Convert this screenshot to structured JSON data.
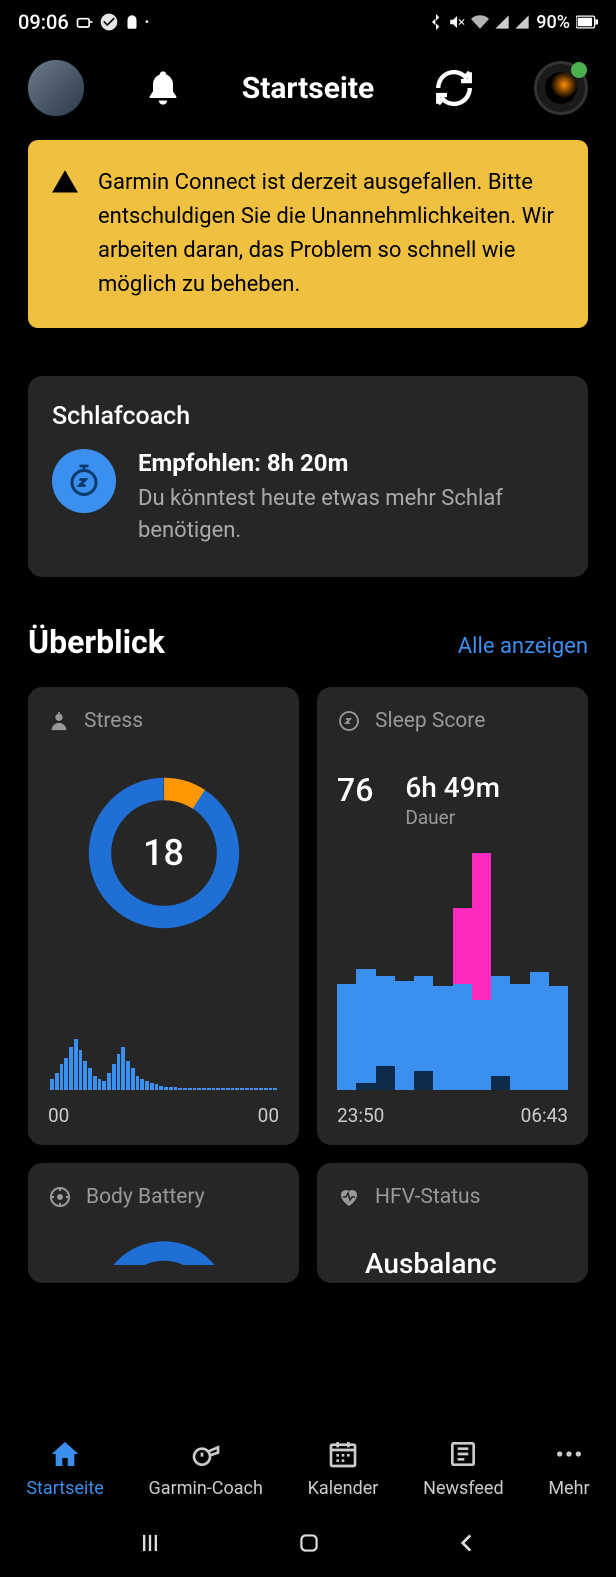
{
  "status": {
    "time": "09:06",
    "battery": "90%"
  },
  "header": {
    "title": "Startseite"
  },
  "alert": {
    "text": "Garmin Connect ist derzeit ausgefallen. Bitte entschuldigen Sie die Unannehmlichkeiten. Wir arbeiten daran, das Problem so schnell wie möglich zu beheben."
  },
  "sleep_coach": {
    "title": "Schlafcoach",
    "recommendation": "Empfohlen: 8h 20m",
    "subtitle": "Du könntest heute etwas mehr Schlaf benötigen."
  },
  "overview": {
    "title": "Überblick",
    "link": "Alle anzeigen"
  },
  "stress": {
    "label": "Stress",
    "value": "18",
    "axis_start": "00",
    "axis_end": "00"
  },
  "sleep": {
    "label": "Sleep Score",
    "score": "76",
    "duration": "6h 49m",
    "duration_label": "Dauer",
    "axis_start": "23:50",
    "axis_end": "06:43"
  },
  "body_battery": {
    "label": "Body Battery"
  },
  "hfv": {
    "label": "HFV-Status",
    "status": "Ausbalanc"
  },
  "nav": {
    "home": "Startseite",
    "coach": "Garmin-Coach",
    "calendar": "Kalender",
    "newsfeed": "Newsfeed",
    "more": "Mehr"
  },
  "chart_data": [
    {
      "type": "bar",
      "title": "Stress",
      "x_range": [
        "00",
        "00"
      ],
      "values": [
        8,
        12,
        18,
        22,
        30,
        35,
        28,
        20,
        15,
        10,
        8,
        6,
        12,
        18,
        25,
        30,
        20,
        15,
        10,
        8,
        6,
        5,
        4,
        3,
        2,
        2,
        2,
        1,
        1,
        1,
        1,
        1,
        1,
        1,
        1,
        1,
        1,
        1,
        1,
        1,
        1,
        1,
        1,
        1,
        1,
        1,
        1,
        1
      ],
      "ylim": [
        0,
        100
      ]
    },
    {
      "type": "bar",
      "title": "Sleep Score",
      "x_range": [
        "23:50",
        "06:43"
      ],
      "series_note": "sleep stages: awake/rem/light/deep",
      "columns": [
        {
          "light": 80
        },
        {
          "light": 85
        },
        {
          "deeper": 15,
          "light": 65
        },
        {
          "light": 82
        },
        {
          "deeper": 12,
          "light": 70
        },
        {
          "light": 78
        },
        {
          "rem": 95,
          "light": 70
        },
        {
          "rem": 100,
          "light": 60
        },
        {
          "deeper": 8,
          "light": 75
        },
        {
          "light": 80
        },
        {
          "light": 90
        },
        {
          "light": 78
        }
      ],
      "colors": {
        "rem": "#ff2bc0",
        "light": "#3b8fef",
        "deeper": "#0d2b4a",
        "awake": "#ff2bc0"
      }
    }
  ]
}
